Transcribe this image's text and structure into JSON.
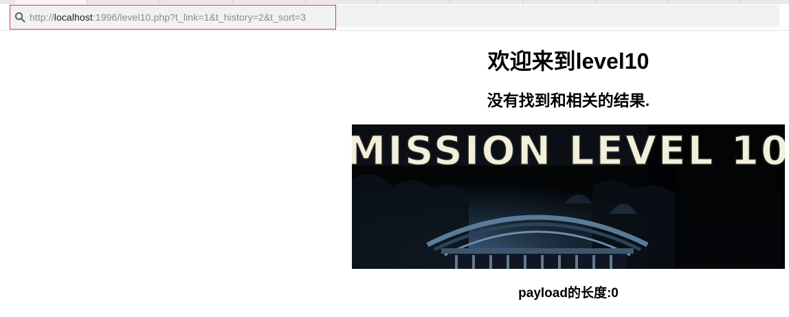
{
  "browser": {
    "address_bar": {
      "url_prefix": "http://",
      "url_host": "localhost",
      "url_rest": ":1996/level10.php?t_link=1&t_history=2&t_sort=3",
      "icon": "search-icon"
    }
  },
  "page": {
    "title": "欢迎来到level10",
    "subtitle": "没有找到和相关的结果.",
    "banner": {
      "text": "MISSION LEVEL 10"
    },
    "payload_length": "payload的长度:0"
  }
}
